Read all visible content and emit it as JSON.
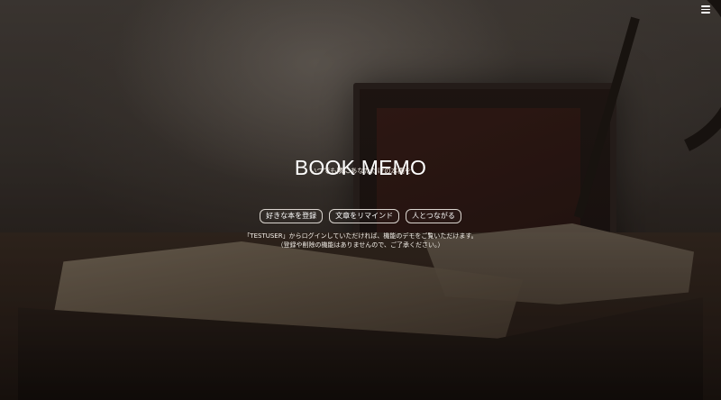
{
  "header": {
    "menu_icon": "hamburger-menu-icon"
  },
  "hero": {
    "title": "BOOK MEMO",
    "subtitle": "いつでも隣にあなただけの本棚を",
    "buttons": [
      {
        "label": "好きな本を登録"
      },
      {
        "label": "文章をリマインド"
      },
      {
        "label": "人とつながる"
      }
    ],
    "notice_line1": "「TESTUSER」からログインしていただければ、機能のデモをご覧いただけます。",
    "notice_line2": "（登録や削除の機能はありませんので、ご了承ください。）"
  },
  "colors": {
    "text": "#ffffff",
    "button_border": "#d9d4ce"
  }
}
